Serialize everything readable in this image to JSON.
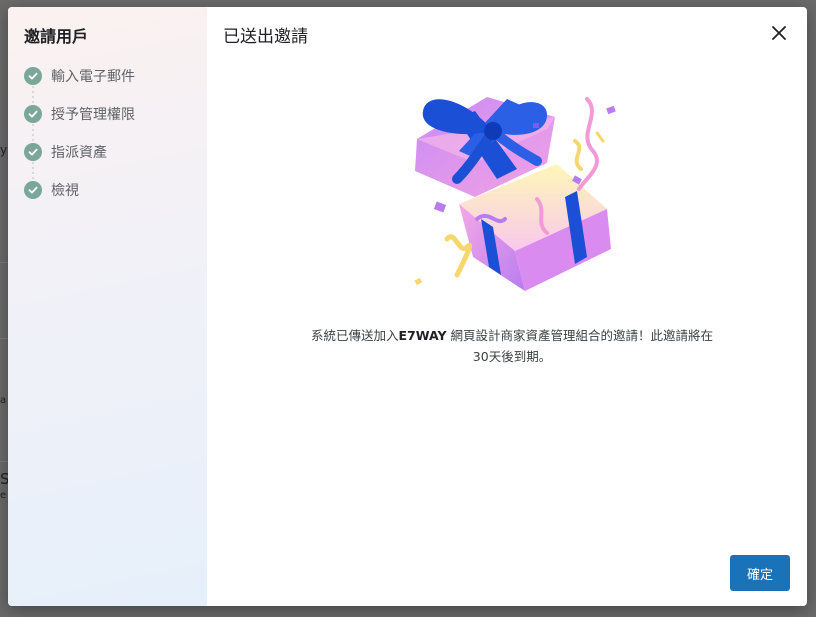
{
  "background": {
    "fragments": [
      "y",
      "a",
      "S",
      "e"
    ]
  },
  "dialog": {
    "stepper": {
      "title": "邀請用戶",
      "steps": [
        {
          "label": "輸入電子郵件",
          "status": "complete"
        },
        {
          "label": "授予管理權限",
          "status": "complete"
        },
        {
          "label": "指派資產",
          "status": "complete"
        },
        {
          "label": "檢視",
          "status": "complete"
        }
      ]
    },
    "content": {
      "title": "已送出邀請",
      "illustration": "gift-box-confetti",
      "message": {
        "prefix": "系統已傳送加入",
        "brand": "E7WAY",
        "suffix": " 網頁設計商家資產管理組合的邀請！此邀請將在30天後到期。"
      },
      "confirm_label": "確定"
    }
  },
  "colors": {
    "accent": "#1a73b8",
    "step_check": "#7aa79a",
    "gift_pink": "#e98fe3",
    "gift_purple": "#b87cf0",
    "ribbon_blue": "#1a4fd6",
    "confetti_yellow": "#f5d76e"
  }
}
